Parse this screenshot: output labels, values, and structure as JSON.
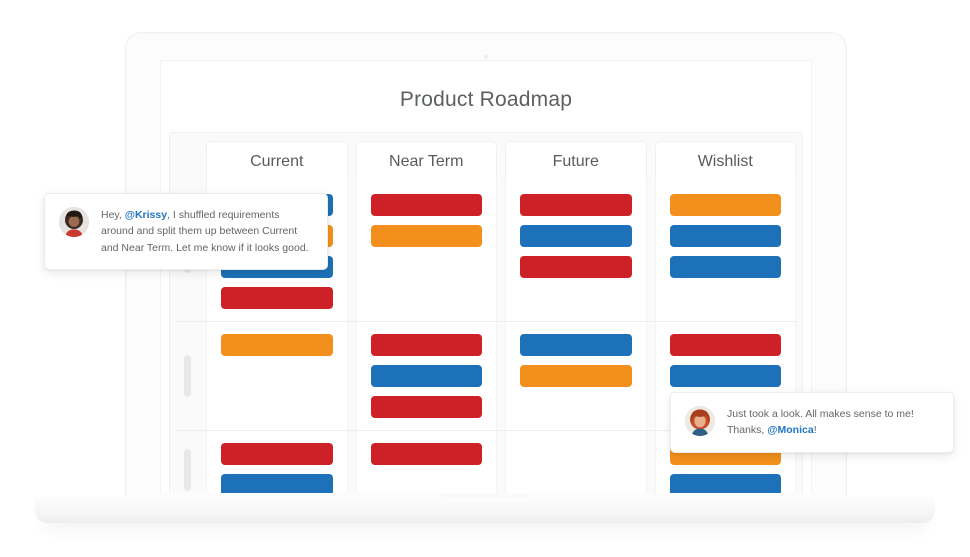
{
  "app": {
    "title": "Product Roadmap",
    "device": "laptop-mockup"
  },
  "board": {
    "columns": [
      {
        "id": "current",
        "label": "Current"
      },
      {
        "id": "near-term",
        "label": "Near Term"
      },
      {
        "id": "future",
        "label": "Future"
      },
      {
        "id": "wishlist",
        "label": "Wishlist"
      }
    ],
    "rows": [
      {
        "id": "row-1",
        "cells": [
          {
            "column": "current",
            "cards": [
              "blue",
              "orange",
              "blue",
              "red"
            ]
          },
          {
            "column": "near-term",
            "cards": [
              "red",
              "orange"
            ]
          },
          {
            "column": "future",
            "cards": [
              "red",
              "blue",
              "red"
            ]
          },
          {
            "column": "wishlist",
            "cards": [
              "orange",
              "blue",
              "blue"
            ]
          }
        ]
      },
      {
        "id": "row-2",
        "cells": [
          {
            "column": "current",
            "cards": [
              "orange"
            ]
          },
          {
            "column": "near-term",
            "cards": [
              "red",
              "blue",
              "red"
            ]
          },
          {
            "column": "future",
            "cards": [
              "blue",
              "orange"
            ]
          },
          {
            "column": "wishlist",
            "cards": [
              "red",
              "blue"
            ]
          }
        ]
      },
      {
        "id": "row-3",
        "cells": [
          {
            "column": "current",
            "cards": [
              "red",
              "blue"
            ]
          },
          {
            "column": "near-term",
            "cards": [
              "red"
            ]
          },
          {
            "column": "future",
            "cards": []
          },
          {
            "column": "wishlist",
            "cards": [
              "orange",
              "blue"
            ]
          }
        ]
      }
    ]
  },
  "comments": [
    {
      "id": "comment-monica",
      "author_avatar": "woman-dark-hair-avatar",
      "segments": [
        {
          "text": "Hey, ",
          "mention": false
        },
        {
          "text": "@Krissy",
          "mention": true
        },
        {
          "text": ", I shuffled requirements around and split them up between Current and Near Term. Let me know if it looks good.",
          "mention": false
        }
      ]
    },
    {
      "id": "comment-krissy",
      "author_avatar": "woman-red-hair-avatar",
      "segments": [
        {
          "text": "Just took a look. All makes sense to me! Thanks, ",
          "mention": false
        },
        {
          "text": "@Monica",
          "mention": true
        },
        {
          "text": "!",
          "mention": false
        }
      ]
    }
  ],
  "colors": {
    "card_red": "#cd2027",
    "card_blue": "#1c71b8",
    "card_orange": "#f3901d",
    "mention_blue": "#2276c6",
    "title_text": "#5d6063",
    "board_background": "#fafafa"
  }
}
